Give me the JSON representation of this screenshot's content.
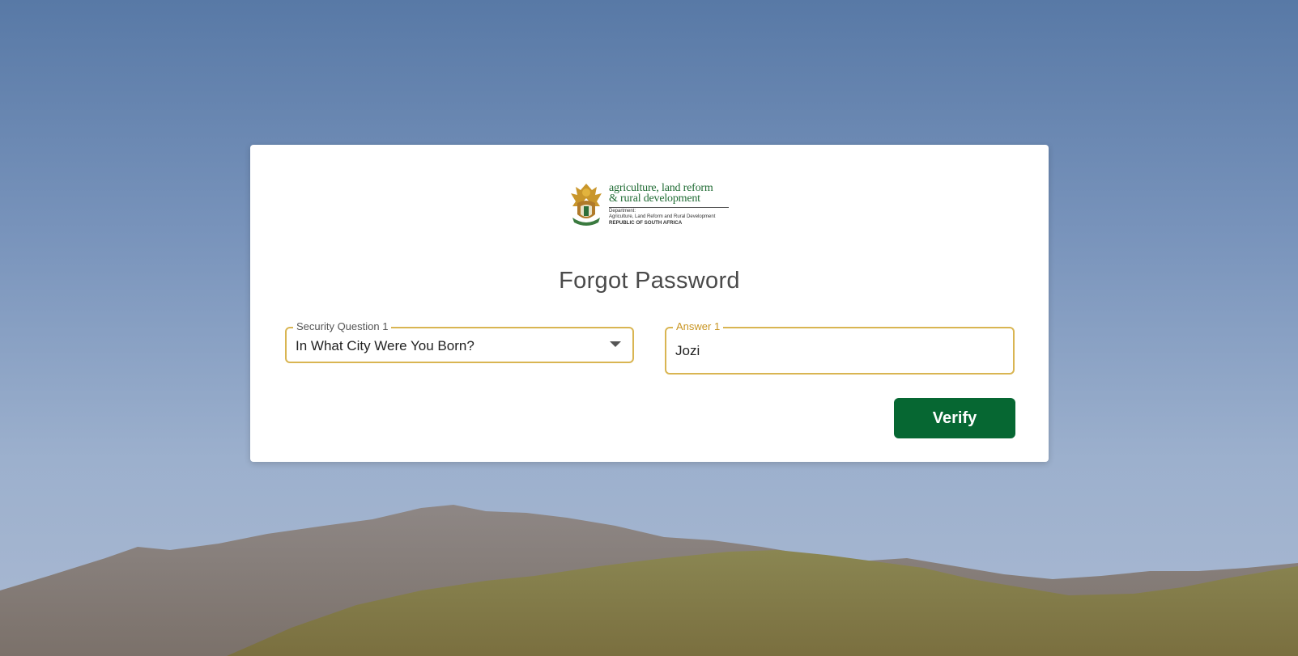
{
  "logo": {
    "line1": "agriculture, land reform",
    "line2": "& rural development",
    "small1": "Department:",
    "small2": "Agriculture, Land Reform and Rural Development",
    "small3": "REPUBLIC OF SOUTH AFRICA"
  },
  "page": {
    "title": "Forgot Password"
  },
  "form": {
    "security_question_label": "Security Question 1",
    "security_question_value": "In What City Were You Born?",
    "answer_label": "Answer 1",
    "answer_value": "Jozi",
    "verify_label": "Verify"
  },
  "colors": {
    "field_border": "#d9b552",
    "answer_label": "#c89522",
    "button": "#066732"
  }
}
